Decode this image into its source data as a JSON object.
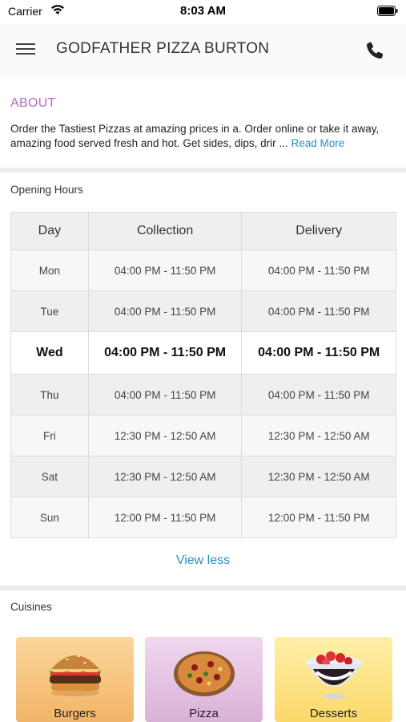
{
  "status_bar": {
    "carrier": "Carrier",
    "time": "8:03 AM"
  },
  "header": {
    "title": "GODFATHER PIZZA BURTON",
    "menu_icon": "hamburger-menu-icon",
    "phone_icon": "phone-icon"
  },
  "about": {
    "heading": "ABOUT",
    "text": "Order the Tastiest Pizzas at amazing prices in a. Order online or take it away, amazing food served fresh and hot. Get sides, dips, drir",
    "ellipsis": "...",
    "read_more": "Read More"
  },
  "opening_hours": {
    "title": "Opening Hours",
    "columns": [
      "Day",
      "Collection",
      "Delivery"
    ],
    "rows": [
      {
        "day": "Mon",
        "collection": "04:00 PM - 11:50 PM",
        "delivery": "04:00 PM - 11:50 PM"
      },
      {
        "day": "Tue",
        "collection": "04:00 PM - 11:50 PM",
        "delivery": "04:00 PM - 11:50 PM"
      },
      {
        "day": "Wed",
        "collection": "04:00 PM - 11:50 PM",
        "delivery": "04:00 PM - 11:50 PM"
      },
      {
        "day": "Thu",
        "collection": "04:00 PM - 11:50 PM",
        "delivery": "04:00 PM - 11:50 PM"
      },
      {
        "day": "Fri",
        "collection": "12:30 PM - 12:50 AM",
        "delivery": "12:30 PM - 12:50 AM"
      },
      {
        "day": "Sat",
        "collection": "12:30 PM - 12:50 AM",
        "delivery": "12:30 PM - 12:50 AM"
      },
      {
        "day": "Sun",
        "collection": "12:00 PM - 11:50 PM",
        "delivery": "12:00 PM - 11:50 PM"
      }
    ],
    "view_less": "View less"
  },
  "cuisines": {
    "title": "Cuisines",
    "items": [
      {
        "label": "Burgers",
        "icon": "burger-icon"
      },
      {
        "label": "Pizza",
        "icon": "pizza-icon"
      },
      {
        "label": "Desserts",
        "icon": "dessert-icon"
      }
    ]
  },
  "colors": {
    "accent_purple": "#b868c8",
    "link_blue": "#2a8fc7"
  }
}
